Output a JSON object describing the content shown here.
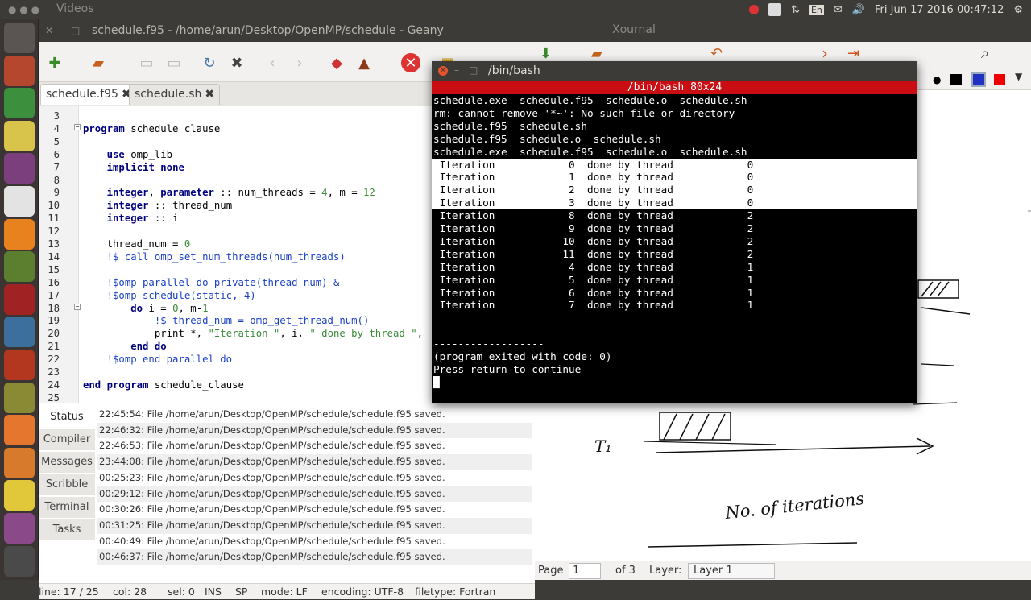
{
  "top_panel": {
    "title": "Videos",
    "clock": "Fri Jun 17 2016 00:47:12",
    "keyboard": "En"
  },
  "launcher": [
    {
      "name": "dash-icon",
      "color": "#5a5552"
    },
    {
      "name": "files-icon",
      "color": "#b5472e"
    },
    {
      "name": "chrome-icon",
      "color": "#3c8f3c"
    },
    {
      "name": "sage-icon",
      "color": "#d8c44a"
    },
    {
      "name": "purple-app-icon",
      "color": "#7b3f7e"
    },
    {
      "name": "writer-icon",
      "color": "#e3e3e3"
    },
    {
      "name": "vlc-icon",
      "color": "#e8821f"
    },
    {
      "name": "tools-icon",
      "color": "#5b7f2e"
    },
    {
      "name": "terminal-icon",
      "color": "#a12222"
    },
    {
      "name": "bird-icon",
      "color": "#3d6f9c"
    },
    {
      "name": "clock-icon",
      "color": "#b3371f"
    },
    {
      "name": "geany-icon",
      "color": "#8a8a35"
    },
    {
      "name": "software-icon",
      "color": "#e5762d"
    },
    {
      "name": "kitten-icon",
      "color": "#d87a2b"
    },
    {
      "name": "linux-icon",
      "color": "#e0c83a"
    },
    {
      "name": "monitor-icon",
      "color": "#8a4a8a"
    },
    {
      "name": "trash-icon",
      "color": "#4a4a4a"
    }
  ],
  "geany": {
    "title": "schedule.f95 - /home/arun/Desktop/OpenMP/schedule - Geany",
    "tabs": [
      {
        "label": "schedule.f95",
        "close": "✖"
      },
      {
        "label": "schedule.sh",
        "close": "✖"
      }
    ],
    "code": [
      {
        "n": "3",
        "t": ""
      },
      {
        "n": "4",
        "t": "program schedule_clause"
      },
      {
        "n": "5",
        "t": ""
      },
      {
        "n": "6",
        "t": "    use omp_lib"
      },
      {
        "n": "7",
        "t": "    implicit none"
      },
      {
        "n": "8",
        "t": ""
      },
      {
        "n": "9",
        "t": "    integer, parameter :: num_threads = 4, m = 12"
      },
      {
        "n": "10",
        "t": "    integer :: thread_num"
      },
      {
        "n": "11",
        "t": "    integer :: i"
      },
      {
        "n": "12",
        "t": ""
      },
      {
        "n": "13",
        "t": "    thread_num = 0"
      },
      {
        "n": "14",
        "t": "    !$ call omp_set_num_threads(num_threads)"
      },
      {
        "n": "15",
        "t": ""
      },
      {
        "n": "16",
        "t": "    !$omp parallel do private(thread_num) &"
      },
      {
        "n": "17",
        "t": "    !$omp schedule(static, 4)"
      },
      {
        "n": "18",
        "t": "        do i = 0, m-1"
      },
      {
        "n": "19",
        "t": "            !$ thread_num = omp_get_thread_num()"
      },
      {
        "n": "20",
        "t": "            print *, \"Iteration \", i, \" done by thread \","
      },
      {
        "n": "21",
        "t": "        end do"
      },
      {
        "n": "22",
        "t": "    !$omp end parallel do"
      },
      {
        "n": "23",
        "t": ""
      },
      {
        "n": "24",
        "t": "end program schedule_clause"
      },
      {
        "n": "25",
        "t": ""
      }
    ],
    "msg_tabs": [
      "Status",
      "Compiler",
      "Messages",
      "Scribble",
      "Terminal",
      "Tasks"
    ],
    "messages": [
      "22:45:54: File /home/arun/Desktop/OpenMP/schedule/schedule.f95 saved.",
      "22:46:32: File /home/arun/Desktop/OpenMP/schedule/schedule.f95 saved.",
      "22:46:53: File /home/arun/Desktop/OpenMP/schedule/schedule.f95 saved.",
      "23:44:08: File /home/arun/Desktop/OpenMP/schedule/schedule.f95 saved.",
      "00:25:23: File /home/arun/Desktop/OpenMP/schedule/schedule.f95 saved.",
      "00:29:12: File /home/arun/Desktop/OpenMP/schedule/schedule.f95 saved.",
      "00:30:26: File /home/arun/Desktop/OpenMP/schedule/schedule.f95 saved.",
      "00:31:25: File /home/arun/Desktop/OpenMP/schedule/schedule.f95 saved.",
      "00:40:49: File /home/arun/Desktop/OpenMP/schedule/schedule.f95 saved.",
      "00:46:37: File /home/arun/Desktop/OpenMP/schedule/schedule.f95 saved."
    ],
    "status": {
      "line": "line: 17 / 25",
      "col": "col: 28",
      "sel": "sel: 0",
      "ins": "INS",
      "sp": "SP",
      "mode": "mode: LF",
      "encoding": "encoding: UTF-8",
      "filetype": "filetype: Fortran"
    }
  },
  "terminal": {
    "title": "/bin/bash",
    "subtitle": "/bin/bash 80x24",
    "lines": [
      {
        "t": "schedule.exe  schedule.f95  schedule.o  schedule.sh",
        "hi": false
      },
      {
        "t": "rm: cannot remove '*~': No such file or directory",
        "hi": false
      },
      {
        "t": "schedule.f95  schedule.sh",
        "hi": false
      },
      {
        "t": "schedule.f95  schedule.o  schedule.sh",
        "hi": false
      },
      {
        "t": "schedule.exe  schedule.f95  schedule.o  schedule.sh",
        "hi": false
      },
      {
        "t": " Iteration            0  done by thread            0",
        "hi": true
      },
      {
        "t": " Iteration            1  done by thread            0",
        "hi": true
      },
      {
        "t": " Iteration            2  done by thread            0",
        "hi": true
      },
      {
        "t": " Iteration            3  done by thread            0",
        "hi": true
      },
      {
        "t": " Iteration            8  done by thread            2",
        "hi": false
      },
      {
        "t": " Iteration            9  done by thread            2",
        "hi": false
      },
      {
        "t": " Iteration           10  done by thread            2",
        "hi": false
      },
      {
        "t": " Iteration           11  done by thread            2",
        "hi": false
      },
      {
        "t": " Iteration            4  done by thread            1",
        "hi": false
      },
      {
        "t": " Iteration            5  done by thread            1",
        "hi": false
      },
      {
        "t": " Iteration            6  done by thread            1",
        "hi": false
      },
      {
        "t": " Iteration            7  done by thread            1",
        "hi": false
      },
      {
        "t": "",
        "hi": false
      },
      {
        "t": "",
        "hi": false
      },
      {
        "t": "------------------",
        "hi": false
      },
      {
        "t": "(program exited with code: 0)",
        "hi": false
      },
      {
        "t": "Press return to continue",
        "hi": false
      },
      {
        "t": "█",
        "hi": false
      }
    ]
  },
  "xournal": {
    "title": "Xournal",
    "page_label": "Page",
    "page_value": "1",
    "of_label": "of 3",
    "layer_label": "Layer:",
    "layer_value": "Layer 1",
    "handwriting": {
      "t1": "T₁",
      "iterations": "No. of iterations"
    }
  }
}
